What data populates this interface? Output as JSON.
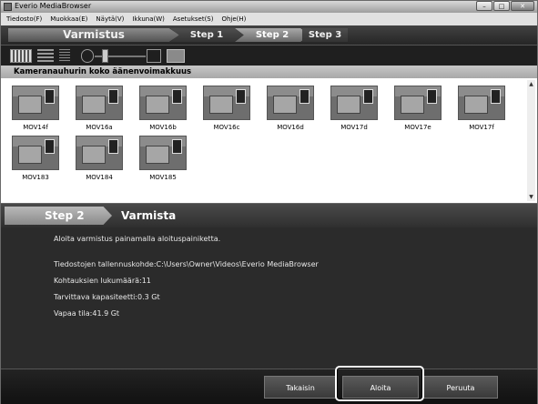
{
  "window": {
    "title": "Everio MediaBrowser"
  },
  "menu": [
    "Tiedosto(F)",
    "Muokkaa(E)",
    "Näytä(V)",
    "Ikkuna(W)",
    "Asetukset(S)",
    "Ohje(H)"
  ],
  "steps": {
    "main": "Varmistus",
    "step1": "Step 1",
    "step2": "Step 2",
    "step3": "Step 3"
  },
  "section": {
    "title": "Kameranauhurin koko äänenvoimakkuus"
  },
  "thumbnails": [
    "MOV14f",
    "MOV16a",
    "MOV16b",
    "MOV16c",
    "MOV16d",
    "MOV17d",
    "MOV17e",
    "MOV17f",
    "MOV183",
    "MOV184",
    "MOV185"
  ],
  "confirm": {
    "step_label": "Step 2",
    "step_title": "Varmista"
  },
  "info": {
    "instruction": "Aloita varmistus painamalla aloituspainiketta.",
    "save_location": "Tiedostojen tallennuskohde:C:\\Users\\Owner\\Videos\\Everio MediaBrowser",
    "scene_count": "Kohtauksien lukumäärä:11",
    "required_space": "Tarvittava kapasiteetti:0.3 Gt",
    "free_space": "Vapaa tila:41.9 Gt"
  },
  "buttons": {
    "back": "Takaisin",
    "start": "Aloita",
    "cancel": "Peruuta"
  }
}
